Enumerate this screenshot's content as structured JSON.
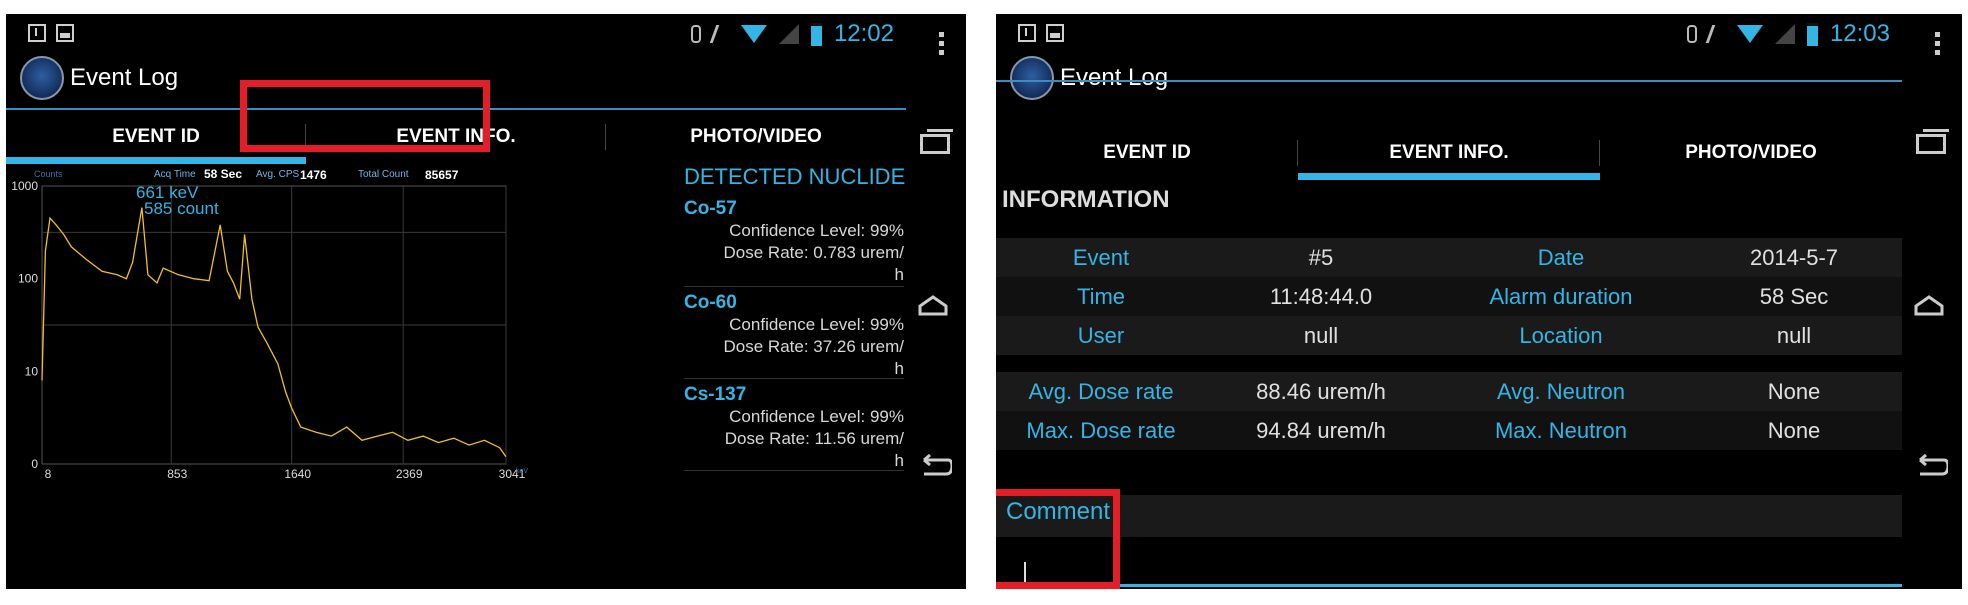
{
  "colors": {
    "accent": "#33b5e5",
    "highlight": "#e41e26",
    "spectrum": "#f0c020"
  },
  "screens": [
    {
      "status": {
        "time": "12:02"
      },
      "app_title": "Event Log",
      "tabs": [
        {
          "label": "EVENT ID"
        },
        {
          "label": "EVENT INFO."
        },
        {
          "label": "PHOTO/VIDEO"
        }
      ],
      "selected_tab": "EVENT ID",
      "spectrum_header": {
        "counts_label": "Counts",
        "acq_time_label": "Acq Time",
        "acq_time_value": "58 Sec",
        "avg_cps_label": "Avg. CPS",
        "avg_cps_value": "1476",
        "total_count_label": "Total Count",
        "total_count_value": "85657"
      },
      "chart_data": {
        "type": "line",
        "title": "",
        "xlabel": "keV",
        "ylabel": "Counts",
        "y_scale": "log",
        "ylim": [
          1,
          1000
        ],
        "y_ticks": [
          "1000",
          "100",
          "10",
          "0"
        ],
        "x_ticks": [
          "8",
          "853",
          "1640",
          "2369",
          "3041"
        ],
        "xlim": [
          8,
          3041
        ],
        "annotation": {
          "energy": "661 keV",
          "count": "585 count"
        },
        "series": [
          {
            "x": [
              8,
              30,
              60,
              100,
              150,
              200,
              300,
              400,
              500,
              560,
              600,
              661,
              700,
              760,
              800,
              900,
              1000,
              1100,
              1173,
              1220,
              1260,
              1300,
              1332,
              1380,
              1420,
              1480,
              1550,
              1600,
              1640,
              1700,
              1800,
              1900,
              2000,
              2100,
              2200,
              2300,
              2400,
              2500,
              2600,
              2700,
              2800,
              2900,
              3000,
              3041
            ],
            "y": [
              8,
              200,
              450,
              380,
              300,
              220,
              160,
              120,
              110,
              100,
              150,
              585,
              110,
              90,
              130,
              110,
              100,
              95,
              380,
              120,
              90,
              60,
              300,
              60,
              30,
              20,
              12,
              6,
              4,
              2.5,
              2.2,
              2,
              2.5,
              1.8,
              2,
              2.2,
              1.8,
              2,
              1.7,
              1.9,
              1.6,
              1.8,
              1.5,
              1.2
            ]
          }
        ]
      },
      "nuclide_panel": {
        "heading": "DETECTED NUCLIDE",
        "items": [
          {
            "name": "Co-57",
            "confidence": "Confidence Level: 99%",
            "dose": "Dose Rate: 0.783 urem/",
            "dose_unit": "h"
          },
          {
            "name": "Co-60",
            "confidence": "Confidence Level: 99%",
            "dose": "Dose Rate: 37.26 urem/",
            "dose_unit": "h"
          },
          {
            "name": "Cs-137",
            "confidence": "Confidence Level: 99%",
            "dose": "Dose Rate: 11.56 urem/",
            "dose_unit": "h"
          }
        ]
      }
    },
    {
      "status": {
        "time": "12:03"
      },
      "app_title": "Event Log",
      "tabs": [
        {
          "label": "EVENT ID"
        },
        {
          "label": "EVENT INFO."
        },
        {
          "label": "PHOTO/VIDEO"
        }
      ],
      "selected_tab": "EVENT INFO.",
      "info_title": "INFORMATION",
      "info_rows_top": [
        {
          "k1": "Event",
          "v1": "#5",
          "k2": "Date",
          "v2": "2014-5-7"
        },
        {
          "k1": "Time",
          "v1": "11:48:44.0",
          "k2": "Alarm duration",
          "v2": "58 Sec"
        },
        {
          "k1": "User",
          "v1": "null",
          "k2": "Location",
          "v2": "null"
        }
      ],
      "info_rows_bottom": [
        {
          "k1": "Avg. Dose rate",
          "v1": "88.46 urem/h",
          "k2": "Avg. Neutron",
          "v2": "None"
        },
        {
          "k1": "Max. Dose rate",
          "v1": "94.84 urem/h",
          "k2": "Max. Neutron",
          "v2": "None"
        }
      ],
      "comment_label": "Comment",
      "comment_value": ""
    }
  ]
}
